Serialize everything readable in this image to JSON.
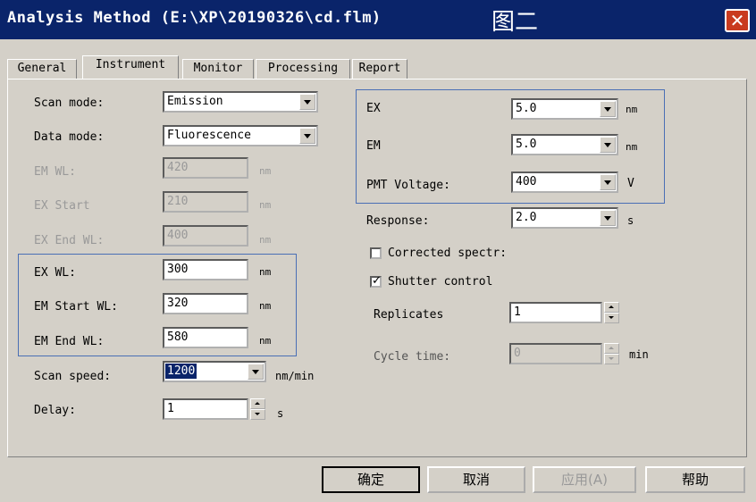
{
  "window": {
    "title": "Analysis Method (E:\\XP\\20190326\\cd.flm)",
    "note": "图二"
  },
  "tabs": [
    "General",
    "Instrument",
    "Monitor",
    "Processing",
    "Report"
  ],
  "left": {
    "scan_mode": {
      "label": "Scan mode:",
      "value": "Emission"
    },
    "data_mode": {
      "label": "Data mode:",
      "value": "Fluorescence"
    },
    "em_wl": {
      "label": "EM WL:",
      "value": "420",
      "unit": "nm"
    },
    "ex_start": {
      "label": "EX Start",
      "value": "210",
      "unit": "nm"
    },
    "ex_end_wl": {
      "label": "EX End WL:",
      "value": "400",
      "unit": "nm"
    },
    "ex_wl": {
      "label": "EX WL:",
      "value": "300",
      "unit": "nm"
    },
    "em_start_wl": {
      "label": "EM Start WL:",
      "value": "320",
      "unit": "nm"
    },
    "em_end_wl": {
      "label": "EM End WL:",
      "value": "580",
      "unit": "nm"
    },
    "scan_speed": {
      "label": "Scan speed:",
      "value": "1200",
      "unit": "nm/min"
    },
    "delay": {
      "label": "Delay:",
      "value": "1",
      "unit": "s"
    }
  },
  "right": {
    "ex": {
      "label": "EX",
      "value": "5.0",
      "unit": "nm"
    },
    "em": {
      "label": "EM",
      "value": "5.0",
      "unit": "nm"
    },
    "pmt_voltage": {
      "label": "PMT Voltage:",
      "value": "400",
      "unit": "V"
    },
    "response": {
      "label": "Response:",
      "value": "2.0",
      "unit": "s"
    },
    "corrected_spectra": {
      "label": "Corrected spectr:",
      "checked": false
    },
    "shutter_control": {
      "label": "Shutter control",
      "checked": true,
      "mark": "✓"
    },
    "replicates": {
      "label": "Replicates",
      "value": "1"
    },
    "cycle_time": {
      "label": "Cycle time:",
      "value": "0",
      "unit": "min"
    }
  },
  "buttons": {
    "ok": "确定",
    "cancel": "取消",
    "apply": "应用(A)",
    "help": "帮助"
  },
  "icons": {
    "close": "close-icon",
    "dropdown": "chevron-down-icon",
    "spinner": "spinner-arrows-icon"
  },
  "colors": {
    "titlebar": "#0a246a",
    "close_button": "#c93a1e",
    "highlight_box": "#4a6fb5",
    "dialog_bg": "#d4d0c8"
  }
}
